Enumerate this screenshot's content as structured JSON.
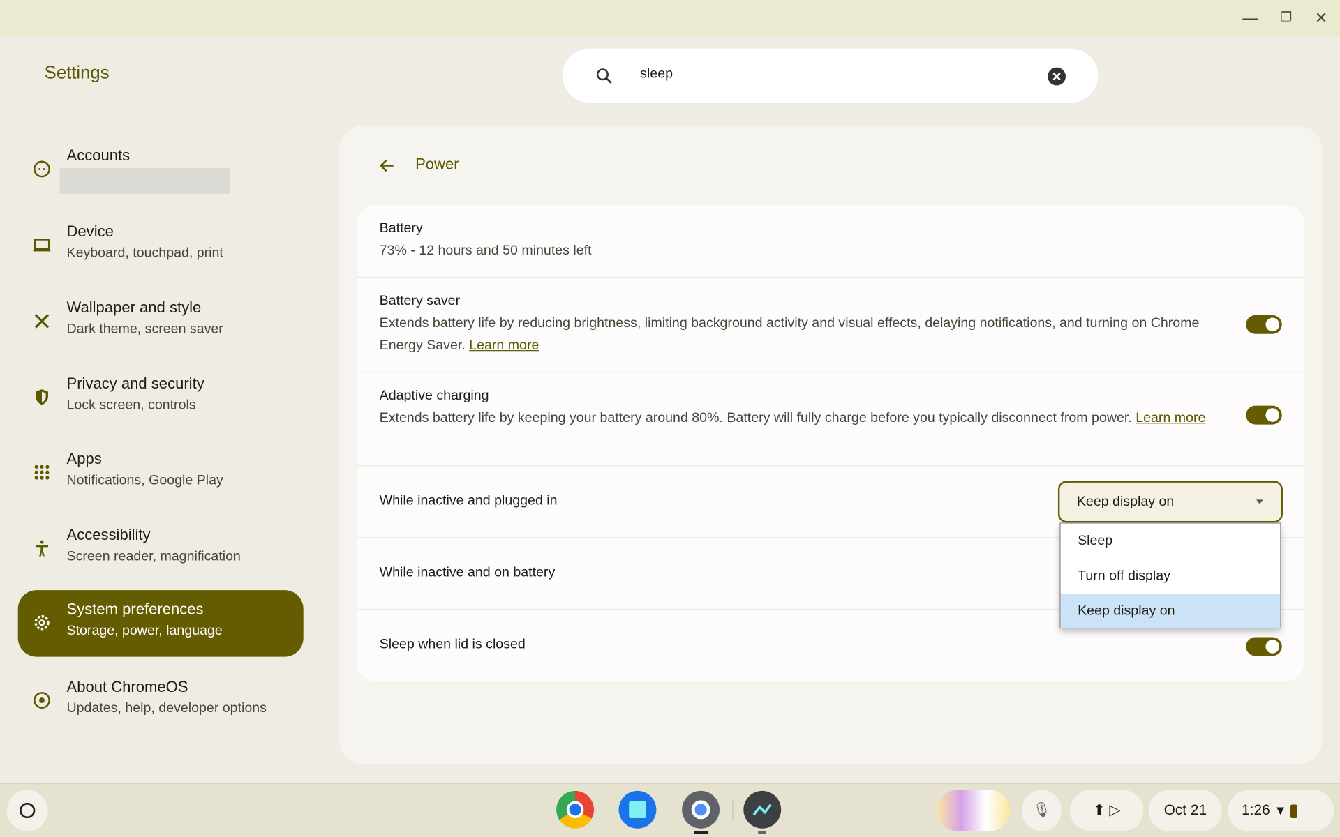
{
  "window": {
    "minimize": "minimize",
    "maximize": "restore",
    "close": "close"
  },
  "app_title": "Settings",
  "search": {
    "value": "sleep",
    "placeholder": ""
  },
  "sidebar": {
    "items": [
      {
        "title": "Accounts",
        "subtitle": "",
        "icon": "account-face-icon"
      },
      {
        "title": "Device",
        "subtitle": "Keyboard, touchpad, print",
        "icon": "laptop-icon"
      },
      {
        "title": "Wallpaper and style",
        "subtitle": "Dark theme, screen saver",
        "icon": "palette-icon"
      },
      {
        "title": "Privacy and security",
        "subtitle": "Lock screen, controls",
        "icon": "shield-icon"
      },
      {
        "title": "Apps",
        "subtitle": "Notifications, Google Play",
        "icon": "apps-grid-icon"
      },
      {
        "title": "Accessibility",
        "subtitle": "Screen reader, magnification",
        "icon": "accessibility-icon"
      },
      {
        "title": "System preferences",
        "subtitle": "Storage, power, language",
        "icon": "gear-icon",
        "active": true
      },
      {
        "title": "About ChromeOS",
        "subtitle": "Updates, help, developer options",
        "icon": "chromeos-icon"
      }
    ]
  },
  "page": {
    "title": "Power",
    "battery": {
      "title": "Battery",
      "status": "73% - 12 hours and 50 minutes left"
    },
    "battery_saver": {
      "title": "Battery saver",
      "desc": "Extends battery life by reducing brightness, limiting background activity and visual effects, delaying notifications, and turning on Chrome Energy Saver.",
      "link": "Learn more",
      "on": true
    },
    "adaptive_charging": {
      "title": "Adaptive charging",
      "desc": "Extends battery life by keeping your battery around 80%. Battery will fully charge before you typically disconnect from power.",
      "link": "Learn more",
      "on": true
    },
    "plugged_in": {
      "title": "While inactive and plugged in",
      "value": "Keep display on",
      "options": [
        "Sleep",
        "Turn off display",
        "Keep display on"
      ]
    },
    "on_battery": {
      "title": "While inactive and on battery"
    },
    "lid": {
      "title": "Sleep when lid is closed",
      "on": true
    }
  },
  "shelf": {
    "date": "Oct 21",
    "time": "1:26",
    "apps": [
      "Chrome",
      "Files",
      "Settings",
      "Diagnostics"
    ]
  },
  "colors": {
    "accent": "#645c00",
    "highlight": "#cce2f6"
  }
}
